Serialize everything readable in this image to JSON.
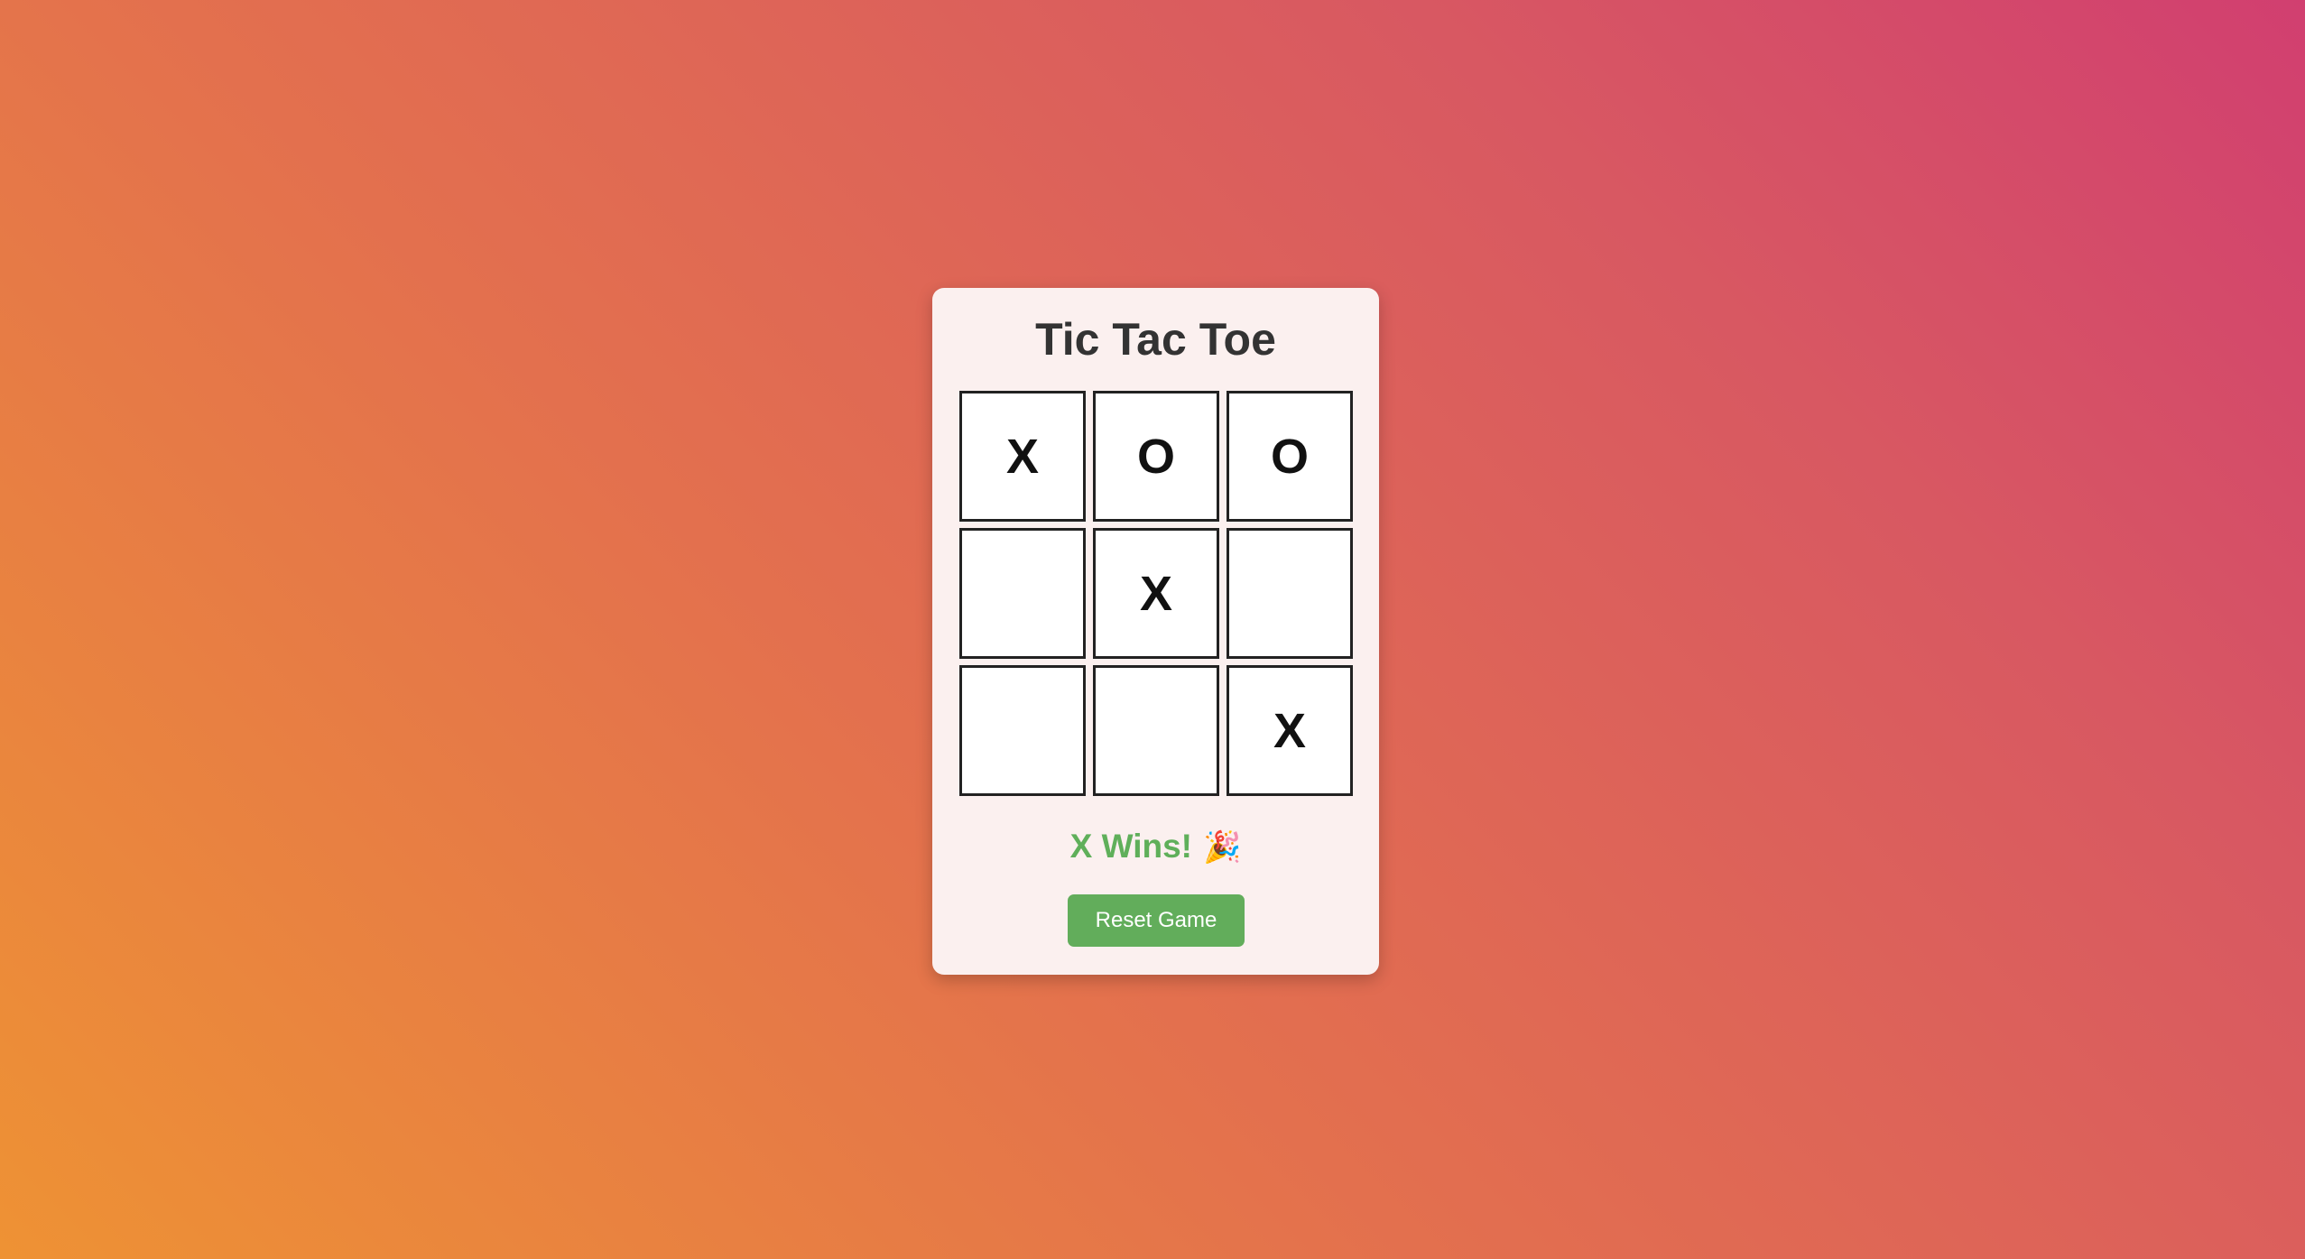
{
  "title": "Tic Tac Toe",
  "board": {
    "cells": [
      "X",
      "O",
      "O",
      "",
      "X",
      "",
      "",
      "",
      "X"
    ]
  },
  "status": {
    "text": "X Wins!",
    "emoji": "🎉"
  },
  "reset_button": {
    "label": "Reset Game"
  },
  "colors": {
    "background_start": "#ee9234",
    "background_end": "#d13f70",
    "card": "#fbf0ef",
    "accent_green": "#62ad5b",
    "status_green": "#5faf5a",
    "title_text": "#333333"
  }
}
